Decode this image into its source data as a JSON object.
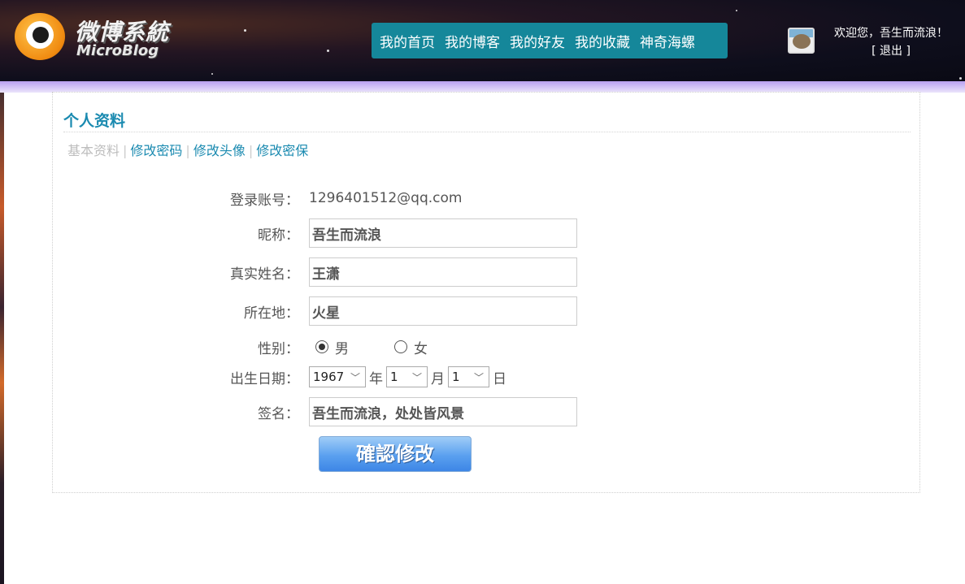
{
  "header": {
    "logo_cn": "微博系統",
    "logo_en": "MicroBlog",
    "nav": [
      "我的首页",
      "我的博客",
      "我的好友",
      "我的收藏",
      "神奇海螺"
    ],
    "welcome": "欢迎您，吾生而流浪！",
    "logout": "[ 退出 ]"
  },
  "profile": {
    "title": "个人资料",
    "subnav": {
      "basic": "基本资料",
      "password": "修改密码",
      "avatar": "修改头像",
      "security": "修改密保",
      "sep": "|"
    },
    "fields": {
      "account_label": "登录账号：",
      "account_value": "1296401512@qq.com",
      "nickname_label": "昵称：",
      "nickname_value": "吾生而流浪",
      "realname_label": "真实姓名：",
      "realname_value": "王潇",
      "location_label": "所在地：",
      "location_value": "火星",
      "gender_label": "性别：",
      "gender_male": "男",
      "gender_female": "女",
      "birthday_label": "出生日期：",
      "birth_year": "1967",
      "year_unit": "年",
      "birth_month": "1",
      "month_unit": "月",
      "birth_day": "1",
      "day_unit": "日",
      "signature_label": "签名：",
      "signature_value": "吾生而流浪，处处皆风景"
    },
    "submit_label": "確認修改"
  },
  "colors": {
    "nav_bg": "#15879a",
    "link": "#1a8ab0",
    "purple_bar": "#b8a0f0"
  }
}
